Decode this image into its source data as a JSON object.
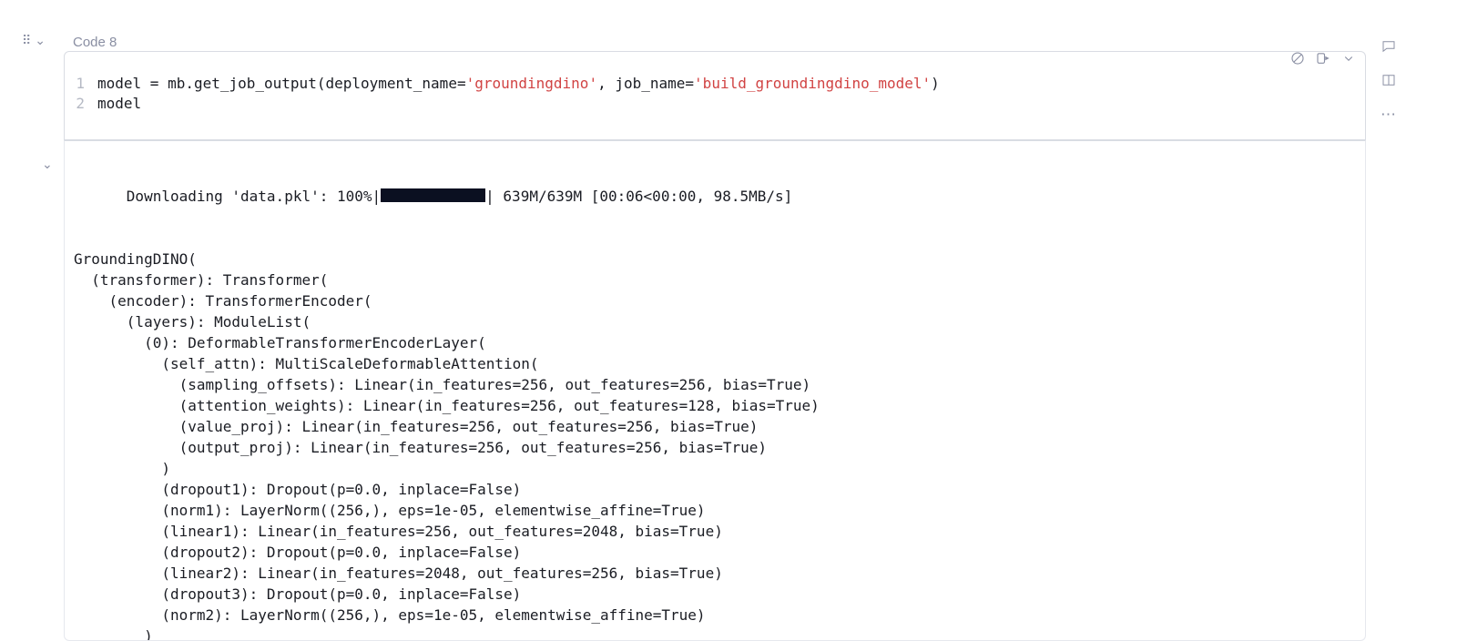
{
  "cell": {
    "label": "Code 8",
    "lines": [
      {
        "n": "1",
        "parts": [
          {
            "t": "plain",
            "v": "model = mb.get_job_output(deployment_name="
          },
          {
            "t": "str",
            "v": "'groundingdino'"
          },
          {
            "t": "plain",
            "v": ", job_name="
          },
          {
            "t": "str",
            "v": "'build_groundingdino_model'"
          },
          {
            "t": "plain",
            "v": ")"
          }
        ]
      },
      {
        "n": "2",
        "parts": [
          {
            "t": "plain",
            "v": "model"
          }
        ]
      }
    ]
  },
  "toolbar": {
    "clear": "clear-output",
    "run": "run-cell",
    "more": "more-run"
  },
  "sidebar": {
    "comment": "add-comment",
    "split": "split-view",
    "more": "more-actions"
  },
  "download": {
    "prefix": "Downloading 'data.pkl': 100%|",
    "suffix": "| 639M/639M [00:06<00:00, 98.5MB/s]"
  },
  "output_lines": [
    "",
    "GroundingDINO(",
    "  (transformer): Transformer(",
    "    (encoder): TransformerEncoder(",
    "      (layers): ModuleList(",
    "        (0): DeformableTransformerEncoderLayer(",
    "          (self_attn): MultiScaleDeformableAttention(",
    "            (sampling_offsets): Linear(in_features=256, out_features=256, bias=True)",
    "            (attention_weights): Linear(in_features=256, out_features=128, bias=True)",
    "            (value_proj): Linear(in_features=256, out_features=256, bias=True)",
    "            (output_proj): Linear(in_features=256, out_features=256, bias=True)",
    "          )",
    "          (dropout1): Dropout(p=0.0, inplace=False)",
    "          (norm1): LayerNorm((256,), eps=1e-05, elementwise_affine=True)",
    "          (linear1): Linear(in_features=256, out_features=2048, bias=True)",
    "          (dropout2): Dropout(p=0.0, inplace=False)",
    "          (linear2): Linear(in_features=2048, out_features=256, bias=True)",
    "          (dropout3): Dropout(p=0.0, inplace=False)",
    "          (norm2): LayerNorm((256,), eps=1e-05, elementwise_affine=True)",
    "        )"
  ]
}
